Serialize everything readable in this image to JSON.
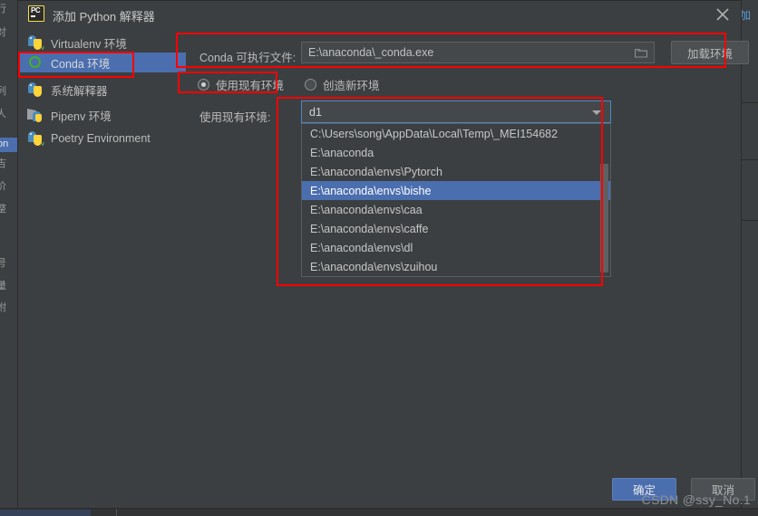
{
  "window": {
    "title": "添加 Python 解释器",
    "app_icon": "pycharm-logo-icon",
    "close_icon": "close-icon"
  },
  "background": {
    "left_strip_chars": [
      "行",
      "对",
      "",
      "列",
      "人",
      "",
      "吉",
      "价",
      "整",
      "",
      "号",
      "量",
      "附"
    ],
    "left_strip_selected": "on",
    "right_edge_fragment": "加"
  },
  "sidebar": {
    "items": [
      {
        "label": "Virtualenv 环境",
        "icon": "python-venv-icon",
        "selected": false
      },
      {
        "label": "Conda 环境",
        "icon": "conda-ring-icon",
        "selected": true
      },
      {
        "label": "系统解释器",
        "icon": "python-icon",
        "selected": false
      },
      {
        "label": "Pipenv 环境",
        "icon": "pipenv-icon",
        "selected": false
      },
      {
        "label": "Poetry Environment",
        "icon": "python-poetry-icon",
        "selected": false
      }
    ]
  },
  "form": {
    "conda_exe": {
      "label": "Conda 可执行文件:",
      "value": "E:\\anaconda\\_conda.exe",
      "placeholder": "",
      "browse_icon": "folder-browse-icon"
    },
    "load_env_button": "加载环境",
    "mode_radios": [
      {
        "label": "使用现有环境",
        "checked": true
      },
      {
        "label": "创造新环境",
        "checked": false
      }
    ],
    "existing_env": {
      "label": "使用现有环境:",
      "value": "d1",
      "dropdown_open": true,
      "options": [
        "C:\\Users\\song\\AppData\\Local\\Temp\\_MEI154682",
        "E:\\anaconda",
        "E:\\anaconda\\envs\\Pytorch",
        "E:\\anaconda\\envs\\bishe",
        "E:\\anaconda\\envs\\caa",
        "E:\\anaconda\\envs\\caffe",
        "E:\\anaconda\\envs\\dl",
        "E:\\anaconda\\envs\\zuihou"
      ],
      "selected_option_index": 3
    }
  },
  "footer": {
    "ok_label": "确定",
    "cancel_label": "取消"
  },
  "annotations": {
    "highlight_color": "#ff0000",
    "boxes": [
      "conda-nav-item",
      "conda-executable-row",
      "use-existing-radio",
      "environment-dropdown"
    ]
  },
  "watermark": "CSDN @ssy_No.1"
}
